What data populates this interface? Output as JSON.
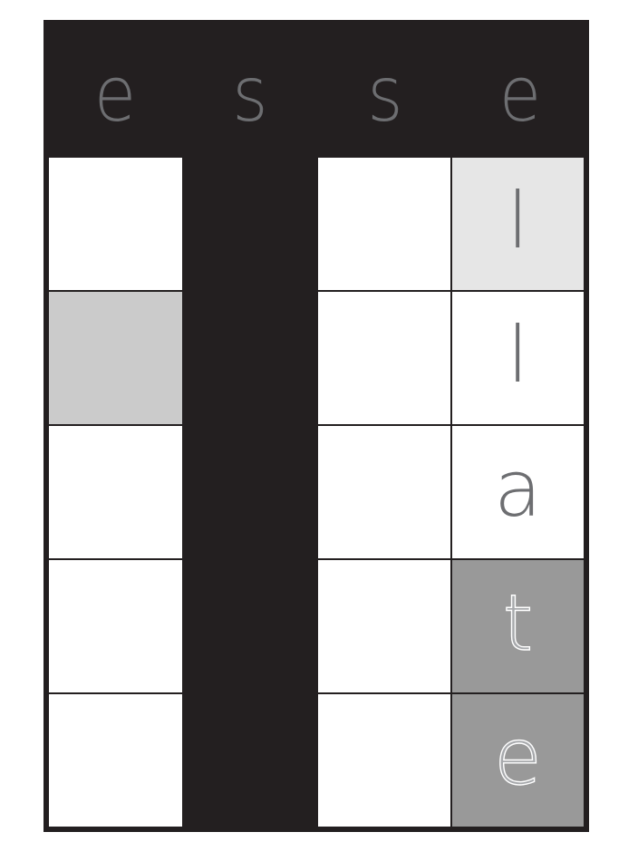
{
  "header": {
    "letters": [
      "e",
      "s",
      "s",
      "e"
    ]
  },
  "grid": {
    "columns": [
      {
        "rows": [
          {
            "letter": "",
            "fill": "#ffffff"
          },
          {
            "letter": "",
            "fill": "#cbcbcb"
          },
          {
            "letter": "",
            "fill": "#ffffff"
          },
          {
            "letter": "",
            "fill": "#ffffff"
          },
          {
            "letter": "",
            "fill": "#ffffff"
          }
        ]
      },
      {
        "blocked": true,
        "fill": "#231f20"
      },
      {
        "rows": [
          {
            "letter": "",
            "fill": "#ffffff"
          },
          {
            "letter": "",
            "fill": "#ffffff"
          },
          {
            "letter": "",
            "fill": "#ffffff"
          },
          {
            "letter": "",
            "fill": "#ffffff"
          },
          {
            "letter": "",
            "fill": "#ffffff"
          }
        ]
      },
      {
        "rows": [
          {
            "letter": "l",
            "fill": "#e6e6e6"
          },
          {
            "letter": "l",
            "fill": "#ffffff"
          },
          {
            "letter": "a",
            "fill": "#ffffff"
          },
          {
            "letter": "t",
            "fill": "#999999",
            "outlined": true
          },
          {
            "letter": "e",
            "fill": "#999999",
            "outlined": true
          }
        ]
      }
    ]
  },
  "colors": {
    "board": "#231f20",
    "header_text": "#6d6e71",
    "cell_text": "#6d6e71",
    "highlight_light": "#e6e6e6",
    "highlight_mid": "#cbcbcb",
    "highlight_dark": "#999999"
  }
}
